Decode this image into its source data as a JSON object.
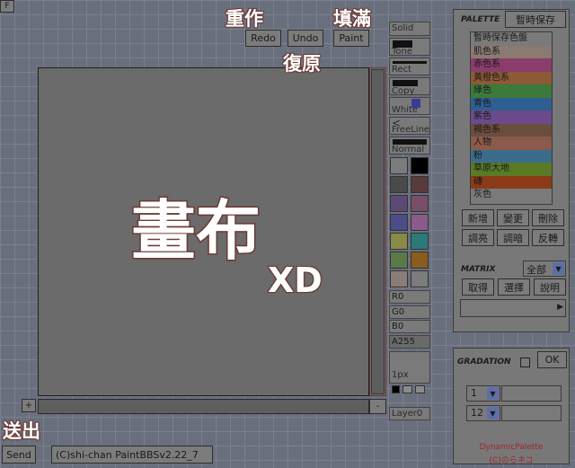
{
  "top_button": "F",
  "toolbar": {
    "redo": "Redo",
    "undo": "Undo",
    "paint": "Paint",
    "send": "Send",
    "plus": "+",
    "minus": "-"
  },
  "credit": "(C)shi-chan PaintBBSv2.22_7",
  "annotations": {
    "redo": "重作",
    "fill": "填滿",
    "undo": "復原",
    "canvas": "畫布",
    "xd": "XD",
    "send": "送出"
  },
  "tools": {
    "solid": "Solid",
    "tone": "Tone",
    "rect": "Rect",
    "copy": "Copy",
    "white": "White",
    "freeline": "FreeLine",
    "normal": "Normal",
    "r": "R0",
    "g": "G0",
    "b": "B0",
    "a": "A255",
    "size": "1px",
    "layer": "Layer0"
  },
  "swatches": [
    "#7c7c7c",
    "#000000",
    "#4a4a4a",
    "#5a3b3b",
    "#5c4a74",
    "#7a4e66",
    "#4c4c86",
    "#8a5a8a",
    "#8a8a48",
    "#2a7a7a",
    "#5a7a4a",
    "#8a5c1e",
    "#8c7c78",
    "#7c7c7c"
  ],
  "palette": {
    "title": "PALETTE",
    "save_label": "暫時保存",
    "items": [
      {
        "label": "暫時保存色盤",
        "color": "#7a7a7a"
      },
      {
        "label": "肌色系",
        "color": "#8a7a72"
      },
      {
        "label": "赤色系",
        "color": "#8a3c6c"
      },
      {
        "label": "黃橙色系",
        "color": "#8c5a34"
      },
      {
        "label": "綠色",
        "color": "#3c7a3c"
      },
      {
        "label": "青色",
        "color": "#2f5f92"
      },
      {
        "label": "紫色",
        "color": "#6a4a8a"
      },
      {
        "label": "褐色系",
        "color": "#6a4e3e"
      },
      {
        "label": "人物",
        "color": "#8a5a4a"
      },
      {
        "label": "粉",
        "color": "#3c6c8c"
      },
      {
        "label": "草原大地",
        "color": "#5a7a26"
      },
      {
        "label": "磚",
        "color": "#8a3a16"
      },
      {
        "label": "灰色",
        "color": "#7a7a7a"
      }
    ],
    "buttons": [
      "新增",
      "變更",
      "刪除",
      "調亮",
      "調暗",
      "反轉"
    ]
  },
  "matrix": {
    "title": "MATRIX",
    "select_value": "全部",
    "buttons": [
      "取得",
      "選擇",
      "說明"
    ]
  },
  "gradation": {
    "title": "GRADATION",
    "ok": "OK",
    "select1": "1",
    "select2": "12"
  },
  "footer": {
    "line1": "DynamicPalette",
    "line2": "(C)のらネコ"
  }
}
